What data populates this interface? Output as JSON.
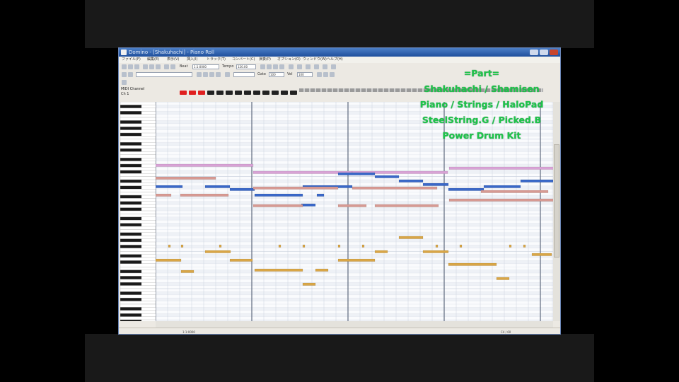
{
  "frame": {
    "letterbox_color": "#000000",
    "band_color": "#191919"
  },
  "window": {
    "title": "Domino - [Shakuhachi] - Piano Roll",
    "menu": [
      "ファイル(F)",
      "編集(E)",
      "表示(V)",
      "挿入(I)",
      "トラック(T)",
      "コンバート(C)",
      "演奏(P)",
      "オプション(O)",
      "ウィンドウ(W)",
      "ヘルプ(H)"
    ],
    "toolbar": {
      "tempo_label": "Tempo",
      "tempo_value": "120.00",
      "beat_label": "Beat",
      "position_value": "1:1:0000",
      "gate_label": "Gate",
      "gate_value": "100",
      "vel_label": "Vel",
      "vel_value": "100"
    },
    "trackbar": {
      "label": "MIDI Channel",
      "sub": "Ch 1"
    },
    "status": {
      "left": "1:1:0000",
      "right": "C4 / 60"
    }
  },
  "colors": {
    "note_violet": "#d9a3d6",
    "note_blue": "#3a68c8",
    "note_salmon": "#d79a93",
    "note_gold": "#d9a647",
    "overlay_text": "#1ec44a",
    "red_tab": "#e02020"
  },
  "overlay": {
    "heading": "=Part=",
    "lines": [
      "Shakuhachi / Shamisen",
      "Piano / Strings / HaloPad",
      "SteelString.G / Picked.B",
      "Power Drum Kit"
    ]
  }
}
